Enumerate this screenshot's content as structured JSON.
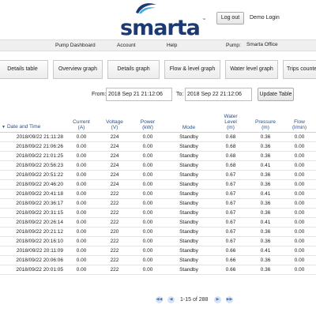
{
  "header": {
    "logo_text": "smarta",
    "logo_tm": "™",
    "logout_label": "Log out",
    "user_name": "Demo Login"
  },
  "menu": {
    "items": [
      "Pump Dashboard",
      "Account",
      "Help"
    ],
    "pump_label": "Pump:",
    "pump_value": "Smarta Office"
  },
  "tabs": [
    "Details table",
    "Overview graph",
    "Details graph",
    "Flow & level graph",
    "Water level graph",
    "Trips counter"
  ],
  "filter": {
    "from_label": "From:",
    "from_value": "2018 Sep 21 21:12:06",
    "to_label": "To:",
    "to_value": "2018 Sep 22 21:12:06",
    "update_label": "Update Table"
  },
  "table": {
    "sort_icon": "triangle-down",
    "columns": [
      {
        "l1": "",
        "l2": "",
        "l3": "Date and Time"
      },
      {
        "l1": "",
        "l2": "Current",
        "l3": "(A)"
      },
      {
        "l1": "",
        "l2": "Voltage",
        "l3": "(V)"
      },
      {
        "l1": "",
        "l2": "Power",
        "l3": "(kW)"
      },
      {
        "l1": "",
        "l2": "",
        "l3": "Mode"
      },
      {
        "l1": "Water",
        "l2": "Level",
        "l3": "(m)"
      },
      {
        "l1": "",
        "l2": "Pressure",
        "l3": "(m)"
      },
      {
        "l1": "",
        "l2": "Flow",
        "l3": "(l/min)"
      }
    ],
    "rows": [
      [
        "2018/09/22 21:11:28",
        "0.00",
        "224",
        "0.00",
        "Standby",
        "0.68",
        "0.36",
        "0.00"
      ],
      [
        "2018/09/22 21:06:26",
        "0.00",
        "224",
        "0.00",
        "Standby",
        "0.68",
        "0.36",
        "0.00"
      ],
      [
        "2018/09/22 21:01:25",
        "0.00",
        "224",
        "0.00",
        "Standby",
        "0.68",
        "0.36",
        "0.00"
      ],
      [
        "2018/09/22 20:56:23",
        "0.00",
        "224",
        "0.00",
        "Standby",
        "0.68",
        "0.41",
        "0.00"
      ],
      [
        "2018/09/22 20:51:22",
        "0.00",
        "224",
        "0.00",
        "Standby",
        "0.67",
        "0.36",
        "0.00"
      ],
      [
        "2018/09/22 20:46:20",
        "0.00",
        "224",
        "0.00",
        "Standby",
        "0.67",
        "0.36",
        "0.00"
      ],
      [
        "2018/09/22 20:41:18",
        "0.00",
        "222",
        "0.00",
        "Standby",
        "0.67",
        "0.41",
        "0.00"
      ],
      [
        "2018/09/22 20:36:17",
        "0.00",
        "222",
        "0.00",
        "Standby",
        "0.67",
        "0.36",
        "0.00"
      ],
      [
        "2018/09/22 20:31:15",
        "0.00",
        "222",
        "0.00",
        "Standby",
        "0.67",
        "0.36",
        "0.00"
      ],
      [
        "2018/09/22 20:26:14",
        "0.00",
        "222",
        "0.00",
        "Standby",
        "0.67",
        "0.41",
        "0.00"
      ],
      [
        "2018/09/22 20:21:12",
        "0.00",
        "220",
        "0.00",
        "Standby",
        "0.67",
        "0.36",
        "0.00"
      ],
      [
        "2018/09/22 20:16:10",
        "0.00",
        "222",
        "0.00",
        "Standby",
        "0.67",
        "0.36",
        "0.00"
      ],
      [
        "2018/09/22 20:11:09",
        "0.00",
        "222",
        "0.00",
        "Standby",
        "0.66",
        "0.41",
        "0.00"
      ],
      [
        "2018/09/22 20:06:06",
        "0.00",
        "222",
        "0.00",
        "Standby",
        "0.66",
        "0.36",
        "0.00"
      ],
      [
        "2018/09/22 20:01:05",
        "0.00",
        "222",
        "0.00",
        "Standby",
        "0.66",
        "0.36",
        "0.00"
      ]
    ]
  },
  "pager": {
    "first_icon": "first-page-icon",
    "prev_icon": "prev-page-icon",
    "next_icon": "next-page-icon",
    "last_icon": "last-page-icon",
    "text": "1-15 of 288"
  },
  "colors": {
    "brand": "#1b3a75",
    "header_text": "#2a4f88",
    "menubar_bg": "#efefef",
    "pager_btn": "#d7e3f2"
  }
}
